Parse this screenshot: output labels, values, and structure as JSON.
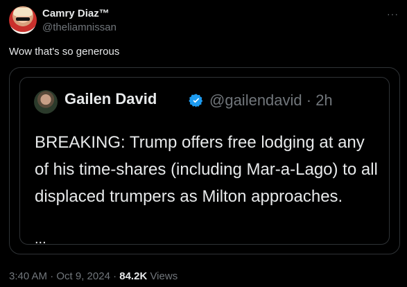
{
  "author": {
    "name": "Camry Diaz™",
    "handle": "@theliamnissan"
  },
  "tweet_text": "Wow that's so generous",
  "quoted": {
    "name": "Gailen David",
    "handle": "@gailendavid · 2h",
    "body": "BREAKING: Trump offers free lodging at any of his time-shares (including Mar-a-Lago) to all displaced trumpers as Milton approaches.",
    "ellipsis": "..."
  },
  "meta": {
    "timestamp": "3:40 AM · Oct 9, 2024 · ",
    "views_count": "84.2K",
    "views_label": " Views"
  },
  "more_icon": "···",
  "colors": {
    "background": "#000000",
    "text": "#e7e9ea",
    "secondary": "#71767b",
    "verified": "#1d9bf0",
    "border": "#2f3336"
  }
}
